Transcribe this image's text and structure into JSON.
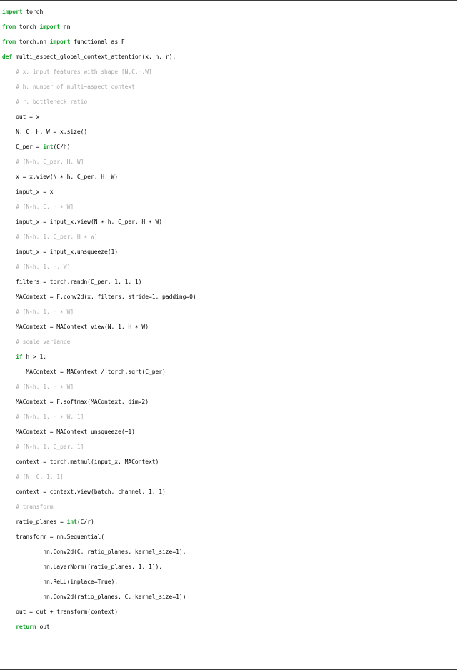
{
  "figure": {
    "kind": "code-listing",
    "language": "python",
    "rule_color": "#3a3a3a",
    "background": "#ffffff",
    "colors": {
      "keyword": "#119e26",
      "comment": "#a8a8a8",
      "code": "#000000"
    }
  },
  "code": {
    "lines": [
      {
        "indent": "",
        "segments": [
          {
            "t": "kw",
            "s": "import"
          },
          {
            "t": "cd",
            "s": " torch"
          }
        ]
      },
      {
        "indent": "",
        "segments": [
          {
            "t": "kw",
            "s": "from"
          },
          {
            "t": "cd",
            "s": " torch "
          },
          {
            "t": "kw",
            "s": "import"
          },
          {
            "t": "cd",
            "s": " nn"
          }
        ]
      },
      {
        "indent": "",
        "segments": [
          {
            "t": "kw",
            "s": "from"
          },
          {
            "t": "cd",
            "s": " torch.nn "
          },
          {
            "t": "kw",
            "s": "import"
          },
          {
            "t": "cd",
            "s": " functional as F"
          }
        ]
      },
      {
        "indent": "",
        "segments": [
          {
            "t": "kw",
            "s": "def"
          },
          {
            "t": "cd",
            "s": " multi_aspect_global_context_attention(x, h, r):"
          }
        ]
      },
      {
        "indent": "    ",
        "segments": [
          {
            "t": "cm",
            "s": "# x: input features with shape [N,C,H,W]"
          }
        ]
      },
      {
        "indent": "    ",
        "segments": [
          {
            "t": "cm",
            "s": "# h: number of multi−aspect context"
          }
        ]
      },
      {
        "indent": "    ",
        "segments": [
          {
            "t": "cm",
            "s": "# r: bottleneck ratio"
          }
        ]
      },
      {
        "indent": "    ",
        "segments": [
          {
            "t": "cd",
            "s": "out = x"
          }
        ]
      },
      {
        "indent": "    ",
        "segments": [
          {
            "t": "cd",
            "s": "N, C, H, W = x.size()"
          }
        ]
      },
      {
        "indent": "    ",
        "segments": [
          {
            "t": "cd",
            "s": "C_per = "
          },
          {
            "t": "kw",
            "s": "int"
          },
          {
            "t": "cd",
            "s": "(C/h)"
          }
        ]
      },
      {
        "indent": "    ",
        "segments": [
          {
            "t": "cm",
            "s": "# [N∗h, C_per, H, W]"
          }
        ]
      },
      {
        "indent": "    ",
        "segments": [
          {
            "t": "cd",
            "s": "x = x.view(N ∗ h, C_per, H, W)"
          }
        ]
      },
      {
        "indent": "    ",
        "segments": [
          {
            "t": "cd",
            "s": "input_x = x"
          }
        ]
      },
      {
        "indent": "    ",
        "segments": [
          {
            "t": "cm",
            "s": "# [N∗h, C, H ∗ W]"
          }
        ]
      },
      {
        "indent": "    ",
        "segments": [
          {
            "t": "cd",
            "s": "input_x = input_x.view(N ∗ h, C_per, H ∗ W)"
          }
        ]
      },
      {
        "indent": "    ",
        "segments": [
          {
            "t": "cm",
            "s": "# [N∗h, 1, C_per, H ∗ W]"
          }
        ]
      },
      {
        "indent": "    ",
        "segments": [
          {
            "t": "cd",
            "s": "input_x = input_x.unsqueeze(1)"
          }
        ]
      },
      {
        "indent": "    ",
        "segments": [
          {
            "t": "cm",
            "s": "# [N∗h, 1, H, W]"
          }
        ]
      },
      {
        "indent": "    ",
        "segments": [
          {
            "t": "cd",
            "s": "filters = torch.randn(C_per, 1, 1, 1)"
          }
        ]
      },
      {
        "indent": "    ",
        "segments": [
          {
            "t": "cd",
            "s": "MAContext = F.conv2d(x, filters, stride=1, padding=0)"
          }
        ]
      },
      {
        "indent": "    ",
        "segments": [
          {
            "t": "cm",
            "s": "# [N∗h, 1, H ∗ W]"
          }
        ]
      },
      {
        "indent": "    ",
        "segments": [
          {
            "t": "cd",
            "s": "MAContext = MAContext.view(N, 1, H ∗ W)"
          }
        ]
      },
      {
        "indent": "    ",
        "segments": [
          {
            "t": "cm",
            "s": "# scale variance"
          }
        ]
      },
      {
        "indent": "    ",
        "segments": [
          {
            "t": "kw",
            "s": "if"
          },
          {
            "t": "cd",
            "s": " h > 1:"
          }
        ]
      },
      {
        "indent": "       ",
        "segments": [
          {
            "t": "cd",
            "s": "MAContext = MAContext / torch.sqrt(C_per)"
          }
        ]
      },
      {
        "indent": "    ",
        "segments": [
          {
            "t": "cm",
            "s": "# [N∗h, 1, H ∗ W]"
          }
        ]
      },
      {
        "indent": "    ",
        "segments": [
          {
            "t": "cd",
            "s": "MAContext = F.softmax(MAContext, dim=2)"
          }
        ]
      },
      {
        "indent": "    ",
        "segments": [
          {
            "t": "cm",
            "s": "# [N∗h, 1, H ∗ W, 1]"
          }
        ]
      },
      {
        "indent": "    ",
        "segments": [
          {
            "t": "cd",
            "s": "MAContext = MAContext.unsqueeze(−1)"
          }
        ]
      },
      {
        "indent": "    ",
        "segments": [
          {
            "t": "cm",
            "s": "# [N∗h, 1, C_per, 1]"
          }
        ]
      },
      {
        "indent": "    ",
        "segments": [
          {
            "t": "cd",
            "s": "context = torch.matmul(input_x, MAContext)"
          }
        ]
      },
      {
        "indent": "    ",
        "segments": [
          {
            "t": "cm",
            "s": "# [N, C, 1, 1]"
          }
        ]
      },
      {
        "indent": "    ",
        "segments": [
          {
            "t": "cd",
            "s": "context = context.view(batch, channel, 1, 1)"
          }
        ]
      },
      {
        "indent": "    ",
        "segments": [
          {
            "t": "cm",
            "s": "# transform"
          }
        ]
      },
      {
        "indent": "    ",
        "segments": [
          {
            "t": "cd",
            "s": "ratio_planes = "
          },
          {
            "t": "kw",
            "s": "int"
          },
          {
            "t": "cd",
            "s": "(C/r)"
          }
        ]
      },
      {
        "indent": "    ",
        "segments": [
          {
            "t": "cd",
            "s": "transform = nn.Sequential("
          }
        ]
      },
      {
        "indent": "            ",
        "segments": [
          {
            "t": "cd",
            "s": "nn.Conv2d(C, ratio_planes, kernel_size=1),"
          }
        ]
      },
      {
        "indent": "            ",
        "segments": [
          {
            "t": "cd",
            "s": "nn.LayerNorm([ratio_planes, 1, 1]),"
          }
        ]
      },
      {
        "indent": "            ",
        "segments": [
          {
            "t": "cd",
            "s": "nn.ReLU(inplace=True),"
          }
        ]
      },
      {
        "indent": "            ",
        "segments": [
          {
            "t": "cd",
            "s": "nn.Conv2d(ratio_planes, C, kernel_size=1))"
          }
        ]
      },
      {
        "indent": "    ",
        "segments": [
          {
            "t": "cd",
            "s": "out = out + transform(context)"
          }
        ]
      },
      {
        "indent": "    ",
        "segments": [
          {
            "t": "kw",
            "s": "return"
          },
          {
            "t": "cd",
            "s": " out"
          }
        ]
      }
    ]
  }
}
